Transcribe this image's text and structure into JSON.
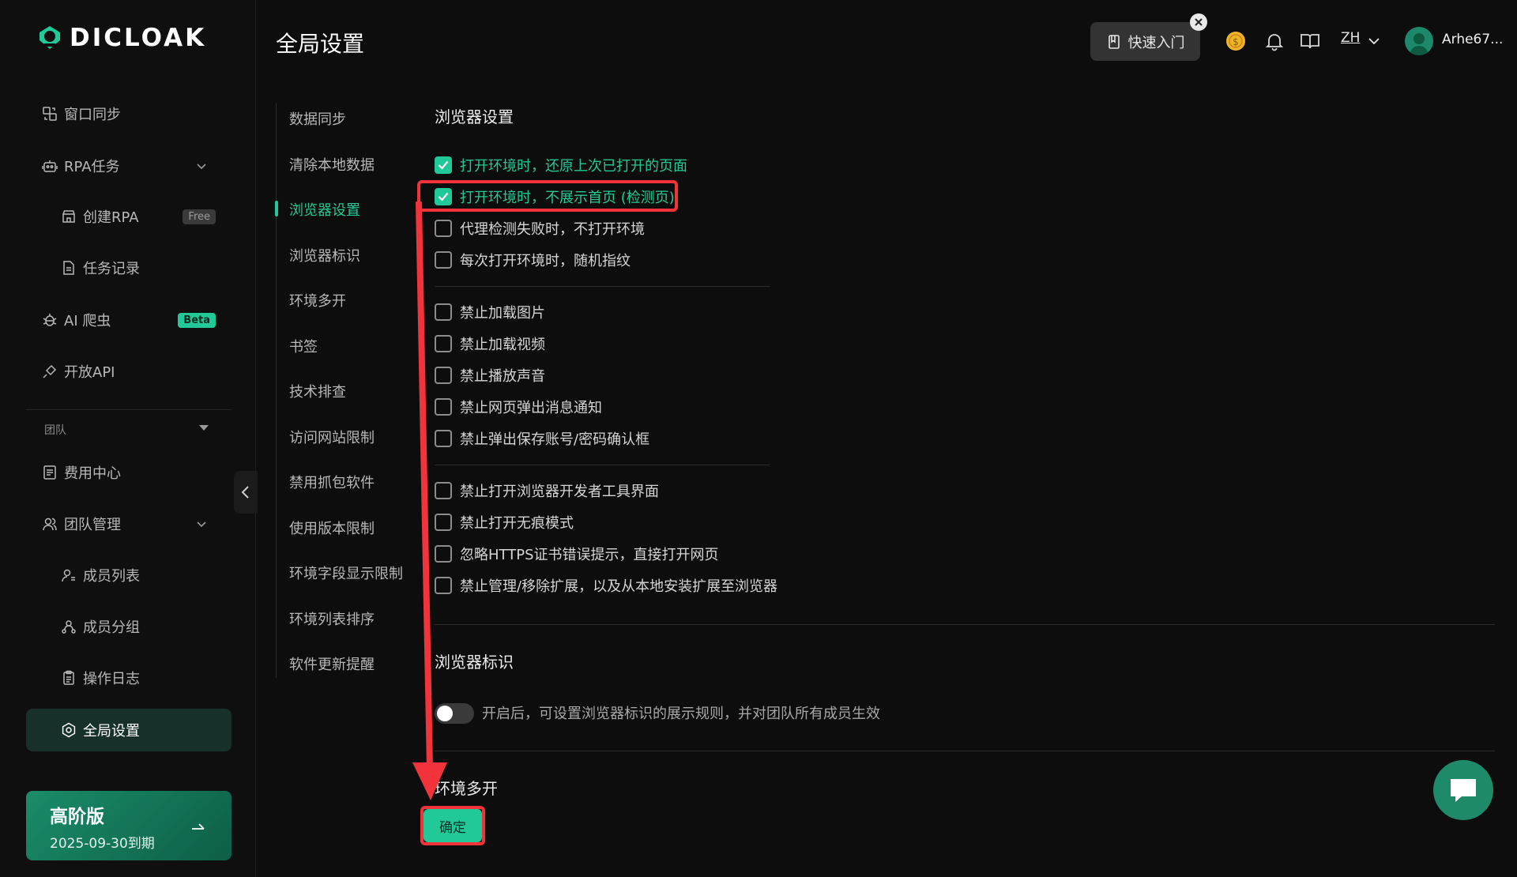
{
  "brand": {
    "name": "DICLOAK"
  },
  "sidebar": {
    "items": [
      {
        "label": "窗口同步",
        "icon": "window-sync-icon"
      },
      {
        "label": "RPA任务",
        "icon": "robot-icon"
      },
      {
        "label": "创建RPA",
        "icon": "shop-icon",
        "badge": "Free"
      },
      {
        "label": "任务记录",
        "icon": "document-icon"
      },
      {
        "label": "AI 爬虫",
        "icon": "bug-icon",
        "badge": "Beta"
      },
      {
        "label": "开放API",
        "icon": "plug-icon"
      },
      {
        "label": "费用中心",
        "icon": "bill-icon"
      },
      {
        "label": "团队管理",
        "icon": "team-icon"
      },
      {
        "label": "成员列表",
        "icon": "member-list-icon"
      },
      {
        "label": "成员分组",
        "icon": "member-group-icon"
      },
      {
        "label": "操作日志",
        "icon": "clipboard-icon"
      },
      {
        "label": "全局设置",
        "icon": "settings-icon",
        "active": true
      }
    ],
    "team_section": "团队",
    "plan": {
      "title": "高阶版",
      "expiry": "2025-09-30到期"
    }
  },
  "header": {
    "title": "全局设置",
    "quick_start": "快速入门",
    "lang": "ZH",
    "username": "Arhe67..."
  },
  "settings_menu": [
    "数据同步",
    "清除本地数据",
    "浏览器设置",
    "浏览器标识",
    "环境多开",
    "书签",
    "技术排查",
    "访问网站限制",
    "禁用抓包软件",
    "使用版本限制",
    "环境字段显示限制",
    "环境列表排序",
    "软件更新提醒"
  ],
  "settings_menu_active": "浏览器设置",
  "browser_settings": {
    "title": "浏览器设置",
    "group1": [
      {
        "label": "打开环境时，还原上次已打开的页面",
        "checked": true
      },
      {
        "label": "打开环境时，不展示首页 (检测页)",
        "checked": true
      },
      {
        "label": "代理检测失败时，不打开环境",
        "checked": false
      },
      {
        "label": "每次打开环境时，随机指纹",
        "checked": false
      }
    ],
    "group2": [
      {
        "label": "禁止加载图片",
        "checked": false
      },
      {
        "label": "禁止加载视频",
        "checked": false
      },
      {
        "label": "禁止播放声音",
        "checked": false
      },
      {
        "label": "禁止网页弹出消息通知",
        "checked": false
      },
      {
        "label": "禁止弹出保存账号/密码确认框",
        "checked": false
      }
    ],
    "group3": [
      {
        "label": "禁止打开浏览器开发者工具界面",
        "checked": false
      },
      {
        "label": "禁止打开无痕模式",
        "checked": false
      },
      {
        "label": "忽略HTTPS证书错误提示，直接打开网页",
        "checked": false
      },
      {
        "label": "禁止管理/移除扩展，以及从本地安装扩展至浏览器",
        "checked": false
      }
    ]
  },
  "browser_identity": {
    "title": "浏览器标识",
    "toggle_on": false,
    "toggle_text": "开启后，可设置浏览器标识的展示规则，并对团队所有成员生效"
  },
  "multi_open": {
    "title": "环境多开"
  },
  "confirm_label": "确定",
  "colors": {
    "accent": "#20c997",
    "annotation": "#f2333b",
    "background": "#0d0d0d"
  }
}
